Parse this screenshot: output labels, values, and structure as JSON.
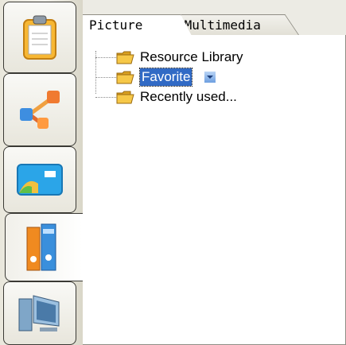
{
  "left_tabs": [
    {
      "icon": "clipboard-icon"
    },
    {
      "icon": "network-diagram-icon"
    },
    {
      "icon": "id-card-icon"
    },
    {
      "icon": "binders-icon",
      "active": true
    },
    {
      "icon": "computer-icon"
    }
  ],
  "tabs": {
    "picture": "Picture",
    "multimedia": "Multimedia"
  },
  "tree": {
    "items": [
      {
        "label": "Resource Library",
        "icon": "folder-icon"
      },
      {
        "label": "Favorite",
        "icon": "folder-icon",
        "selected": true
      },
      {
        "label": "Recently used...",
        "icon": "folder-icon"
      }
    ]
  },
  "colors": {
    "selection": "#316ac5",
    "folder": "#f0c040",
    "tab_background": "#ecebe4"
  }
}
